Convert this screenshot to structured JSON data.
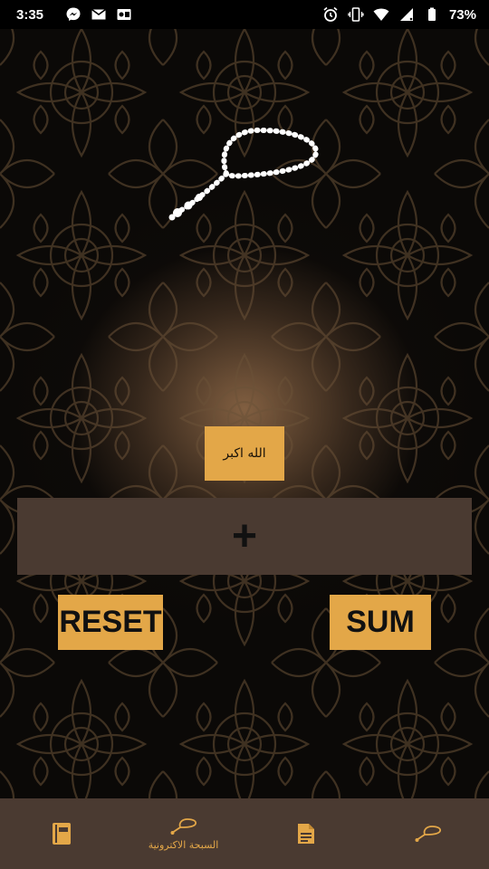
{
  "status_bar": {
    "time": "3:35",
    "battery": "73%",
    "left_icons": [
      "messenger-icon",
      "gmail-icon",
      "outlook-icon"
    ],
    "right_icons": [
      "alarm-icon",
      "vibrate-icon",
      "wifi-icon",
      "signal-icon",
      "battery-icon"
    ]
  },
  "main": {
    "dhikr_text": "الله اكبر",
    "plus_label": "+",
    "reset_label": "RESET",
    "sum_label": "SUM"
  },
  "bottom_nav": {
    "items": [
      {
        "icon": "book-icon",
        "label": ""
      },
      {
        "icon": "tasbih-icon",
        "label": "السبحة الاكترونية"
      },
      {
        "icon": "document-icon",
        "label": ""
      },
      {
        "icon": "tasbih-icon",
        "label": ""
      }
    ]
  },
  "colors": {
    "accent": "#e3a748",
    "panel": "#4a3a31",
    "background": "#000000"
  }
}
